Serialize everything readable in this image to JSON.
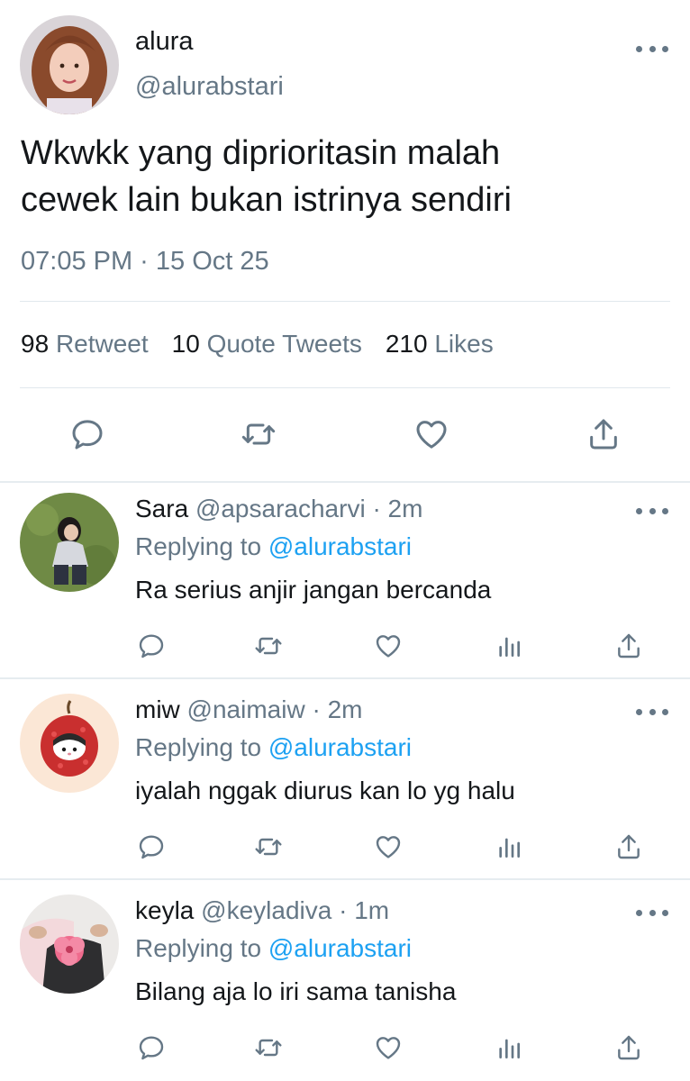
{
  "main_tweet": {
    "name": "alura",
    "handle": "@alurabstari",
    "text_line1": "Wkwkk yang diprioritasin malah",
    "text_line2": "cewek lain bukan istrinya sendiri",
    "timestamp": "07:05 PM · 15 Oct 25",
    "stats": {
      "retweets_count": "98",
      "retweets_label": "Retweet",
      "quotes_count": "10",
      "quotes_label": "Quote Tweets",
      "likes_count": "210",
      "likes_label": "Likes"
    }
  },
  "replies": [
    {
      "name": "Sara",
      "handle": "@apsaracharvi",
      "time": "· 2m",
      "replying_prefix": "Replying to",
      "replying_to": "@alurabstari",
      "text": "Ra serius anjir jangan bercanda"
    },
    {
      "name": "miw",
      "handle": "@naimaiw",
      "time": "· 2m",
      "replying_prefix": "Replying to",
      "replying_to": "@alurabstari",
      "text": "iyalah nggak diurus kan lo yg halu"
    },
    {
      "name": "keyla",
      "handle": "@keyladiva",
      "time": "· 1m",
      "replying_prefix": "Replying to",
      "replying_to": "@alurabstari",
      "text": "Bilang aja lo iri sama tanisha"
    }
  ],
  "icons": {
    "reply": "comment-icon",
    "retweet": "retweet-icon",
    "like": "heart-icon",
    "share": "share-icon",
    "analytics": "analytics-icon",
    "more": "more-icon"
  },
  "colors": {
    "text": "#14171a",
    "secondary": "#657786",
    "link": "#1da1f2",
    "divider": "#e1e8ed"
  }
}
